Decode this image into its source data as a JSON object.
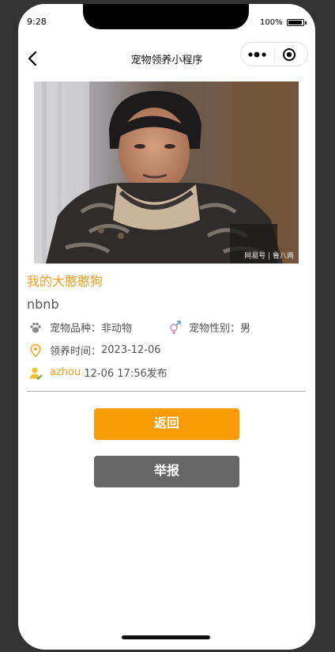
{
  "status_bar": {
    "time": "9:28",
    "battery": "100%"
  },
  "nav": {
    "title": "宠物领养小程序"
  },
  "pet": {
    "name": "我的大憨憨狗",
    "description": "nbnb",
    "photo_watermark": "网易号 | 鲁八两",
    "breed_label": "宠物品种：",
    "breed_value": "非动物",
    "gender_label": "宠物性别：",
    "gender_value": "男",
    "adopt_time_label": "领养时间：",
    "adopt_time_value": "2023-12-06",
    "publisher": "azhou",
    "publish_info": " 12-06 17:56发布"
  },
  "buttons": {
    "back": "返回",
    "report": "举报"
  },
  "colors": {
    "accent": "#f89b05",
    "gray_button": "#666666"
  }
}
